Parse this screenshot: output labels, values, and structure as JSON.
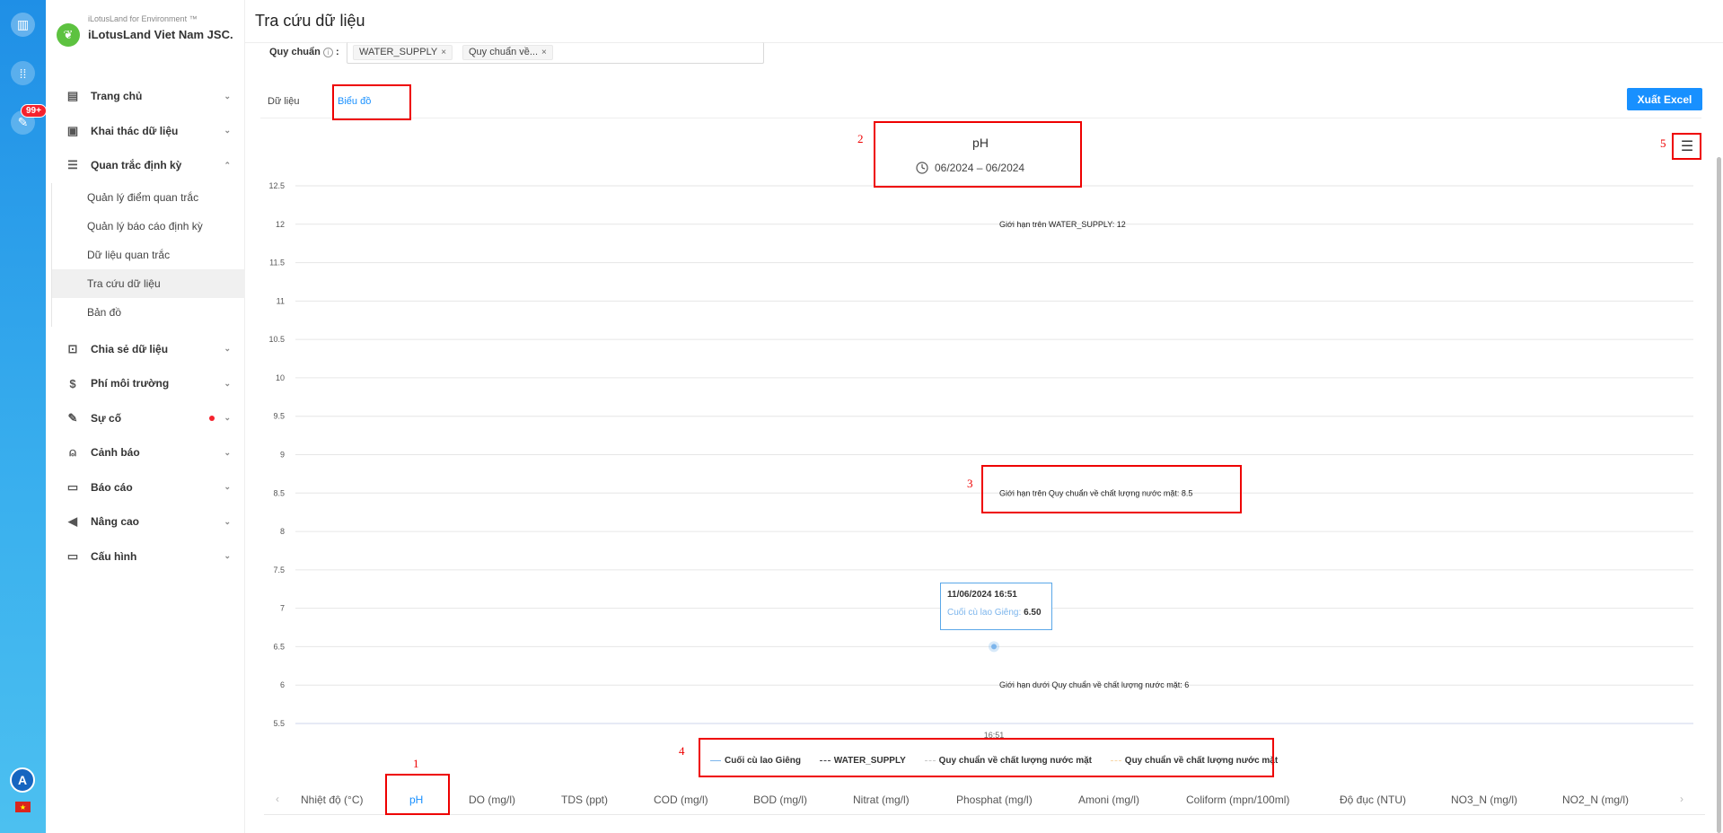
{
  "rail": {
    "badge": "99+",
    "avatar": "A"
  },
  "brand": {
    "sub": "iLotusLand for Environment ™",
    "name": "iLotusLand Viet Nam JSC."
  },
  "sidebar": {
    "items": [
      {
        "label": "Trang chủ",
        "icon": "home-icon"
      },
      {
        "label": "Khai thác dữ liệu",
        "icon": "monitor-icon"
      },
      {
        "label": "Quan trắc định kỳ",
        "icon": "document-icon"
      },
      {
        "label": "Chia sẻ dữ liệu",
        "icon": "share-icon"
      },
      {
        "label": "Phí môi trường",
        "icon": "dollar-icon"
      },
      {
        "label": "Sự cố",
        "icon": "edit-icon"
      },
      {
        "label": "Cảnh báo",
        "icon": "alarm-icon"
      },
      {
        "label": "Báo cáo",
        "icon": "report-icon"
      },
      {
        "label": "Nâng cao",
        "icon": "megaphone-icon"
      },
      {
        "label": "Cấu hình",
        "icon": "settings-icon"
      }
    ],
    "subitems": [
      {
        "label": "Quản lý điểm quan trắc"
      },
      {
        "label": "Quản lý báo cáo định kỳ"
      },
      {
        "label": "Dữ liệu quan trắc"
      },
      {
        "label": "Tra cứu dữ liệu"
      },
      {
        "label": "Bản đồ"
      }
    ]
  },
  "page": {
    "title": "Tra cứu dữ liệu"
  },
  "filter": {
    "label": "Quy chuẩn",
    "tags": [
      "WATER_SUPPLY",
      "Quy chuẩn về..."
    ]
  },
  "tabs": {
    "data": "Dữ liệu",
    "chart": "Biểu đồ"
  },
  "export_label": "Xuất Excel",
  "tooltip": {
    "time": "11/06/2024 16:51",
    "series": "Cuối cù lao Giêng:",
    "value": "6.50"
  },
  "annotations": [
    "1",
    "2",
    "3",
    "4",
    "5"
  ],
  "params": [
    "Nhiệt độ (°C)",
    "pH",
    "DO (mg/l)",
    "TDS (ppt)",
    "COD (mg/l)",
    "BOD (mg/l)",
    "Nitrat (mg/l)",
    "Phosphat (mg/l)",
    "Amoni (mg/l)",
    "Coliform (mpn/100ml)",
    "Độ đục (NTU)",
    "NO3_N (mg/l)",
    "NO2_N (mg/l)"
  ],
  "chart_data": {
    "type": "line",
    "title": "pH",
    "subtitle": "06/2024 – 06/2024",
    "x_ticks": [
      "16:51"
    ],
    "yticks": [
      5.5,
      6,
      6.5,
      7,
      7.5,
      8,
      8.5,
      9,
      9.5,
      10,
      10.5,
      11,
      11.5,
      12,
      12.5
    ],
    "ylim": [
      5.5,
      12.5
    ],
    "series": [
      {
        "name": "Cuối cù lao Giêng",
        "color": "#7cb5ec",
        "points": [
          {
            "x": "11/06/2024 16:51",
            "y": 6.5
          }
        ]
      },
      {
        "name": "WATER_SUPPLY",
        "color": "#434348"
      },
      {
        "name": "Quy chuẩn về chất lượng nước mặt",
        "color": "#c8c8c8"
      },
      {
        "name": "Quy chuẩn về chất lượng nước mặt",
        "color": "#f7d8a8"
      }
    ],
    "plot_lines": [
      {
        "value": 12,
        "label": "Giới hạn trên WATER_SUPPLY: 12"
      },
      {
        "value": 8.5,
        "label": "Giới hạn trên Quy chuẩn về chất lượng nước mặt: 8.5"
      },
      {
        "value": 6,
        "label": "Giới hạn dưới Quy chuẩn về chất lượng nước mặt: 6"
      }
    ],
    "grid": true,
    "legend": "bottom"
  }
}
